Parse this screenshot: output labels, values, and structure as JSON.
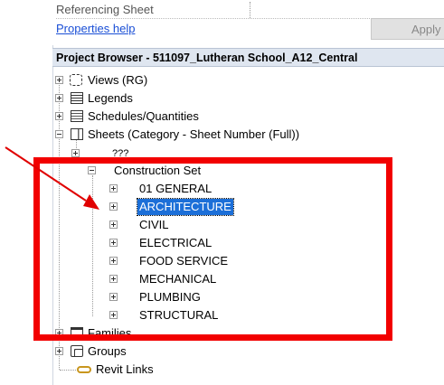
{
  "properties": {
    "referencing_row": "Referencing Sheet",
    "help_link": "Properties help",
    "apply_button": "Apply"
  },
  "project_browser": {
    "title": "Project Browser - 511097_Lutheran School_A12_Central",
    "views": "Views (RG)",
    "legends": "Legends",
    "schedules": "Schedules/Quantities",
    "sheets": "Sheets (Category - Sheet Number (Full))",
    "unknown": "???",
    "construction_set": "Construction Set",
    "categories": [
      "01 GENERAL",
      "ARCHITECTURE",
      "CIVIL",
      "ELECTRICAL",
      "FOOD SERVICE",
      "MECHANICAL",
      "PLUMBING",
      "STRUCTURAL"
    ],
    "selected_category": "ARCHITECTURE",
    "families": "Families",
    "groups": "Groups",
    "revit_links": "Revit Links"
  },
  "annotation": {
    "box_color": "#f20000",
    "arrow_color": "#e00000",
    "selection_color": "#1c6fd8"
  }
}
